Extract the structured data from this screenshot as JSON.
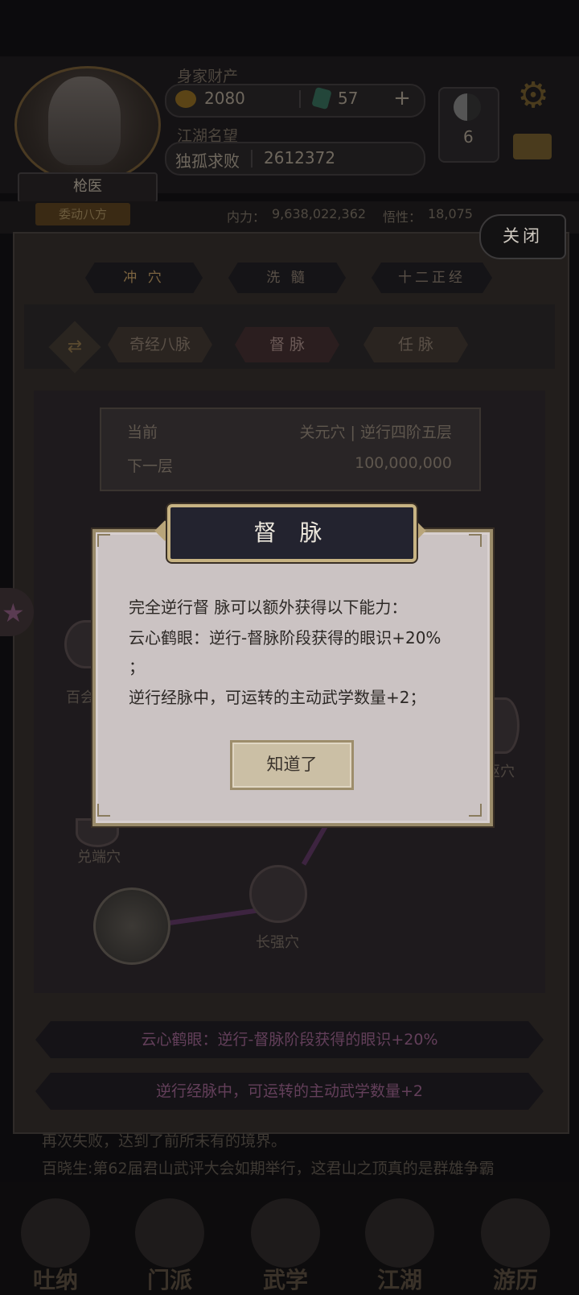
{
  "hud": {
    "resource_title": "身家财产",
    "coins": "2080",
    "jade": "57",
    "rank_title": "江湖名望",
    "player_name": "独孤求败",
    "score": "2612372",
    "taiji_count": "6",
    "role": "枪医",
    "move_label": "委动八方",
    "neili_label": "内力：",
    "neili_value": "9,638,022,362",
    "wuxing_label": "悟性：",
    "wuxing_value": "18,075"
  },
  "panel": {
    "close_label": "关闭",
    "tabs": [
      {
        "label": "冲 穴"
      },
      {
        "label": "洗 髓"
      },
      {
        "label": "十二正经"
      }
    ],
    "subtabs": [
      {
        "label": "奇经八脉"
      },
      {
        "label": "督 脉"
      },
      {
        "label": "任 脉"
      }
    ],
    "info": {
      "current_label": "当前",
      "current_value": "关元穴 | 逆行四阶五层",
      "next_label": "下一层",
      "next_value": "100,000,000"
    },
    "nodes": {
      "baihui": "百会",
      "duiduan": "兑端穴",
      "changqiang": "长强穴",
      "shuqu": "枢穴"
    },
    "abilities": [
      {
        "text": "云心鹤眼：逆行-督脉阶段获得的眼识+20%"
      },
      {
        "text": "逆行经脉中，可运转的主动武学数量+2"
      }
    ]
  },
  "log": {
    "line1": "再次失败，达到了前所未有的境界。",
    "line2": "百晓生:第62届君山武评大会如期举行，这君山之顶真的是群雄争霸"
  },
  "bottom_nav": [
    {
      "label": "吐纳"
    },
    {
      "label": "门派"
    },
    {
      "label": "武学"
    },
    {
      "label": "江湖"
    },
    {
      "label": "游历"
    }
  ],
  "dialog": {
    "title": "督 脉",
    "line1": "完全逆行督  脉可以额外获得以下能力：",
    "line2": "云心鹤眼：逆行-督脉阶段获得的眼识+20%",
    "line3": "；",
    "line4": "逆行经脉中，可运转的主动武学数量+2；",
    "ok_label": "知道了"
  }
}
